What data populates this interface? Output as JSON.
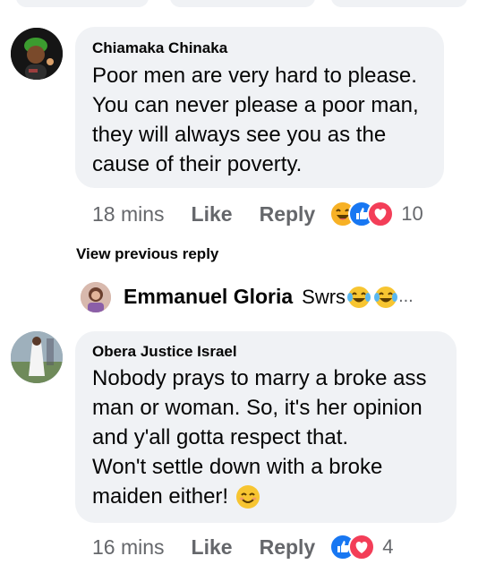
{
  "comments": [
    {
      "author": "Chiamaka Chinaka",
      "lines": [
        "Poor men are very hard to please.",
        "You can never please a poor man,",
        "they will always see you as the",
        "cause of their poverty."
      ],
      "time": "18 mins",
      "like_label": "Like",
      "reply_label": "Reply",
      "reaction_icons": [
        "haha-icon",
        "like-icon",
        "love-icon"
      ],
      "reaction_count": "10"
    },
    {
      "author": "Obera Justice Israel",
      "lines": [
        "Nobody prays to marry a broke ass",
        "man or woman. So, it's her opinion",
        "and y'all gotta respect that.",
        "Won't settle down with a broke",
        "maiden either!"
      ],
      "time": "16 mins",
      "like_label": "Like",
      "reply_label": "Reply",
      "reaction_icons": [
        "like-icon",
        "love-icon"
      ],
      "reaction_count": "4"
    }
  ],
  "view_previous_reply": "View previous reply",
  "reply_preview": {
    "author": "Emmanuel Gloria",
    "text": "Swrs",
    "ellipsis": "..."
  },
  "colors": {
    "bubble": "#f0f2f5",
    "meta_text": "#65676b",
    "like_blue": "#1877f2",
    "love_red": "#f33e58",
    "haha_yellow": "#f7b125"
  }
}
